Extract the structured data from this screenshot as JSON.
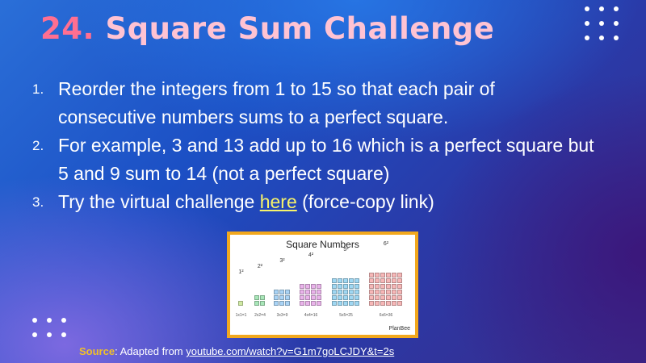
{
  "title": {
    "number": "24.",
    "text": "Square Sum Challenge"
  },
  "list": [
    {
      "n": "1.",
      "text": "Reorder the integers from 1 to 15 so that each pair of consecutive numbers sums to a perfect square."
    },
    {
      "n": "2.",
      "text": "For example, 3 and 13 add up to 16 which is a perfect square but 5 and 9 sum to 14 (not a perfect square)"
    },
    {
      "n": "3.",
      "before": "Try the virtual challenge ",
      "link": "here",
      "after": " (force-copy link)"
    }
  ],
  "figure": {
    "title": "Square Numbers",
    "brand": "PlanBee",
    "squares": [
      {
        "label": "1²",
        "caption": "1x1=1",
        "color": "#cfe9a3"
      },
      {
        "label": "2²",
        "caption": "2x2=4",
        "color": "#a8e6b8"
      },
      {
        "label": "3²",
        "caption": "3x3=9",
        "color": "#a9d3f5"
      },
      {
        "label": "4²",
        "caption": "4x4=16",
        "color": "#e9b3ea"
      },
      {
        "label": "5²",
        "caption": "5x5=25",
        "color": "#9fd7f2"
      },
      {
        "label": "6²",
        "caption": "6x6=36",
        "color": "#f6b7b7"
      }
    ]
  },
  "source": {
    "label": "Source",
    "text": ":  Adapted from ",
    "url": "youtube.com/watch?v=G1m7goLCJDY&t=2s"
  },
  "colors": {
    "accent": "#ff6f91",
    "title_light": "#ffc3d3",
    "link": "#f7f36a",
    "frame": "#f2a81d",
    "source_label": "#f0c02a"
  }
}
